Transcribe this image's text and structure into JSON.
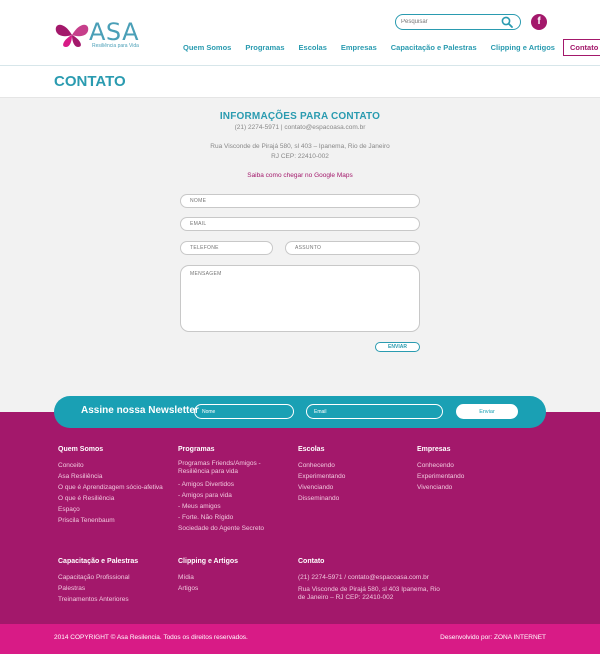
{
  "header": {
    "logo_text": "ASA",
    "logo_tagline": "Resiliência para Vida",
    "search_placeholder": "Pesquisar",
    "facebook_label": "f",
    "nav": [
      "Quem Somos",
      "Programas",
      "Escolas",
      "Empresas",
      "Capacitação e Palestras",
      "Clipping e Artigos",
      "Contato"
    ]
  },
  "page_title": "CONTATO",
  "contact": {
    "heading": "INFORMAÇÕES PARA CONTATO",
    "phone_email": "(21) 2274-5971 | contato@espacoasa.com.br",
    "address_line1": "Rua Visconde de Pirajá 580, sl 403 – Ipanema, Rio de Janeiro",
    "address_line2": "RJ CEP: 22410-002",
    "maps_link": "Saiba como chegar no Google Maps"
  },
  "form": {
    "name_placeholder": "NOME",
    "email_placeholder": "EMAIL",
    "phone_placeholder": "TELEFONE",
    "subject_placeholder": "ASSUNTO",
    "message_placeholder": "MENSAGEM",
    "send_label": "ENVIAR"
  },
  "newsletter": {
    "title": "Assine nossa Newsletter",
    "name_placeholder": "Nome",
    "email_placeholder": "Email",
    "button_label": "Enviar"
  },
  "footer": {
    "quem_somos": {
      "heading": "Quem Somos",
      "items": [
        "Conceito",
        "Asa Resiliência",
        "O que é Aprendizagem sócio-afetiva",
        "O que é Resiliência",
        "Espaço",
        "Priscila Tenenbaum"
      ]
    },
    "programas": {
      "heading": "Programas",
      "items": [
        "Programas Friends/Amigos - Resiliência para vida",
        "- Amigos Divertidos",
        "- Amigos para vida",
        "- Meus amigos",
        "- Forte. Não Rígido",
        "Sociedade do Agente Secreto"
      ]
    },
    "escolas": {
      "heading": "Escolas",
      "items": [
        "Conhecendo",
        "Experimentando",
        "Vivenciando",
        "Disseminando"
      ]
    },
    "empresas": {
      "heading": "Empresas",
      "items": [
        "Conhecendo",
        "Experimentando",
        "Vivenciando"
      ]
    },
    "capacitacao": {
      "heading": "Capacitação e Palestras",
      "items": [
        "Capacitação Profissional",
        "Palestras",
        "Treinamentos Anteriores"
      ]
    },
    "clipping": {
      "heading": "Clipping e Artigos",
      "items": [
        "Mídia",
        "Artigos"
      ]
    },
    "contato": {
      "heading": "Contato",
      "phone_email": "(21) 2274-5971 / contato@espacoasa.com.br",
      "address": "Rua Visconde de Pirajá 580, sl 403 Ipanema, Rio de Janeiro – RJ CEP: 22410-002"
    }
  },
  "bottom": {
    "copyright": "2014 COPYRIGHT © Asa Resilencia. Todos os direitos reservados.",
    "developer": "Desenvolvido por: ZONA INTERNET"
  },
  "colors": {
    "teal": "#2a9bb0",
    "magenta": "#a3186b",
    "pink_bar": "#d81b86",
    "newsletter": "#1aa0b4"
  }
}
